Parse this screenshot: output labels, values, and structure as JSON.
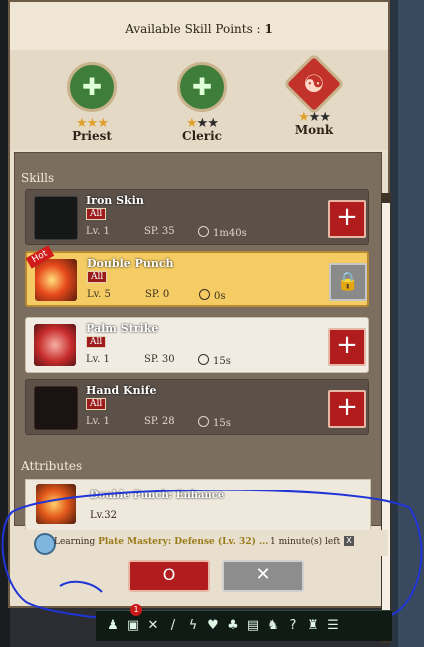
{
  "header": {
    "skill_points_label": "Available Skill Points :",
    "skill_points_value": "1"
  },
  "classes": [
    {
      "name": "Priest",
      "stars_on": 3,
      "stars_total": 3
    },
    {
      "name": "Cleric",
      "stars_on": 1,
      "stars_total": 3
    },
    {
      "name": "Monk",
      "stars_on": 1,
      "stars_total": 3,
      "selected": true
    }
  ],
  "sections": {
    "skills": "Skills",
    "attributes": "Attributes"
  },
  "skills": [
    {
      "name": "Iron Skin",
      "tag": "All",
      "lv": "Lv. 1",
      "sp": "SP. 35",
      "time": "1m40s",
      "action": "+",
      "locked": false
    },
    {
      "name": "Double Punch",
      "tag": "All",
      "lv": "Lv. 5",
      "sp": "SP. 0",
      "time": "0s",
      "action": "lock",
      "locked": true,
      "hot": "Hot"
    },
    {
      "name": "Palm Strike",
      "tag": "All",
      "lv": "Lv. 1",
      "sp": "SP. 30",
      "time": "15s",
      "action": "+",
      "locked": false
    },
    {
      "name": "Hand Knife",
      "tag": "All",
      "lv": "Lv. 1",
      "sp": "SP. 28",
      "time": "15s",
      "action": "+",
      "locked": false
    }
  ],
  "attribute": {
    "name": "Double Punch: Enhance",
    "lv": "Lv.32"
  },
  "learning": {
    "prefix": "Learning",
    "item": "Plate Mastery: Defense (Lv. 32) ...",
    "time_left": "1 minute(s) left",
    "close": "X"
  },
  "buttons": {
    "confirm": "O",
    "cancel": "✕"
  },
  "taskbar": {
    "notification_count": "1"
  },
  "colors": {
    "accent_red": "#b11d1d",
    "gold_highlight": "#f4cc63",
    "annotation_blue": "#1f35d6"
  }
}
